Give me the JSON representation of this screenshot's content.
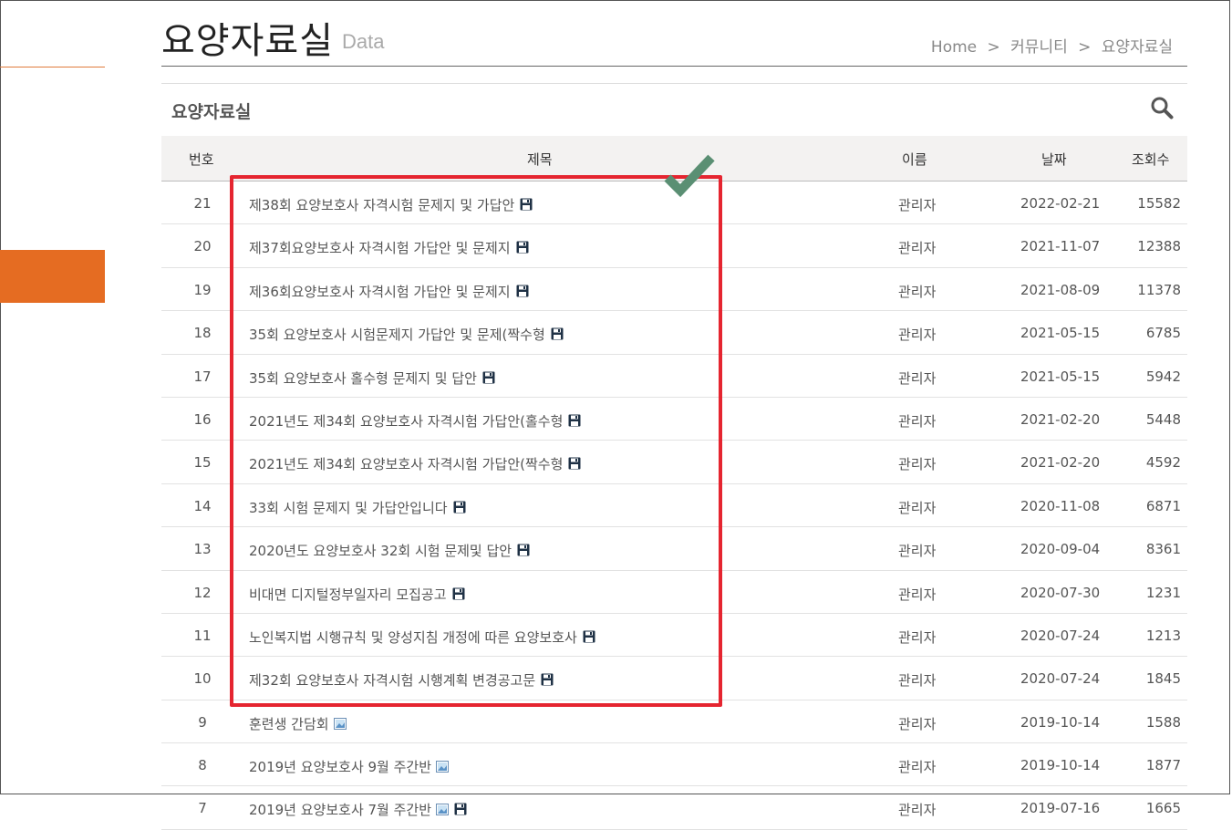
{
  "header": {
    "title": "요양자료실",
    "subtitle": "Data",
    "breadcrumb": [
      "Home",
      "커뮤니티",
      "요양자료실"
    ],
    "separator": ">"
  },
  "board": {
    "title": "요양자료실"
  },
  "table": {
    "headers": [
      "번호",
      "제목",
      "이름",
      "날짜",
      "조회수"
    ],
    "rows": [
      {
        "num": "21",
        "title": "제38회 요양보호사 자격시험 문제지 및 가답안",
        "attach": "disk-icon",
        "name": "관리자",
        "date": "2022-02-21",
        "views": "15582"
      },
      {
        "num": "20",
        "title": "제37회요양보호사 자격시험 가답안 및 문제지",
        "attach": "disk-icon",
        "name": "관리자",
        "date": "2021-11-07",
        "views": "12388"
      },
      {
        "num": "19",
        "title": "제36회요양보호사 자격시험 가답안 및 문제지",
        "attach": "disk-icon",
        "name": "관리자",
        "date": "2021-08-09",
        "views": "11378"
      },
      {
        "num": "18",
        "title": "35회 요양보호사 시험문제지 가답안 및 문제(짝수형",
        "attach": "disk-icon",
        "name": "관리자",
        "date": "2021-05-15",
        "views": "6785"
      },
      {
        "num": "17",
        "title": "35회 요양보호사 홀수형 문제지 및 답안",
        "attach": "disk-icon",
        "name": "관리자",
        "date": "2021-05-15",
        "views": "5942"
      },
      {
        "num": "16",
        "title": "2021년도 제34회 요양보호사 자격시험 가답안(홀수형",
        "attach": "disk-icon",
        "name": "관리자",
        "date": "2021-02-20",
        "views": "5448"
      },
      {
        "num": "15",
        "title": "2021년도 제34회 요양보호사 자격시험 가답안(짝수형",
        "attach": "disk-icon",
        "name": "관리자",
        "date": "2021-02-20",
        "views": "4592"
      },
      {
        "num": "14",
        "title": "33회 시험 문제지 및 가답안입니다",
        "attach": "disk-icon",
        "name": "관리자",
        "date": "2020-11-08",
        "views": "6871"
      },
      {
        "num": "13",
        "title": "2020년도 요양보호사 32회 시험 문제및 답안",
        "attach": "disk-icon",
        "name": "관리자",
        "date": "2020-09-04",
        "views": "8361"
      },
      {
        "num": "12",
        "title": "비대면 디지털정부일자리 모집공고",
        "attach": "disk-icon",
        "name": "관리자",
        "date": "2020-07-30",
        "views": "1231"
      },
      {
        "num": "11",
        "title": "노인복지법 시행규칙 및 양성지침 개정에 따른 요양보호사",
        "attach": "disk-icon",
        "name": "관리자",
        "date": "2020-07-24",
        "views": "1213"
      },
      {
        "num": "10",
        "title": "제32회 요양보호사 자격시험 시행계획 변경공고문",
        "attach": "disk-icon",
        "name": "관리자",
        "date": "2020-07-24",
        "views": "1845"
      },
      {
        "num": "9",
        "title": "훈련생 간담회",
        "attach": "image-icon",
        "name": "관리자",
        "date": "2019-10-14",
        "views": "1588"
      },
      {
        "num": "8",
        "title": "2019년 요양보호사 9월 주간반",
        "attach": "image-icon",
        "name": "관리자",
        "date": "2019-10-14",
        "views": "1877"
      },
      {
        "num": "7",
        "title": "2019년 요양보호사 7월 주간반",
        "attach": "image-disk-icon",
        "name": "관리자",
        "date": "2019-07-16",
        "views": "1665"
      }
    ]
  },
  "colors": {
    "accent": "#e56c22",
    "highlight_border": "#e52530",
    "check_mark": "#5a8f73",
    "header_bg": "#f3f2f1"
  }
}
